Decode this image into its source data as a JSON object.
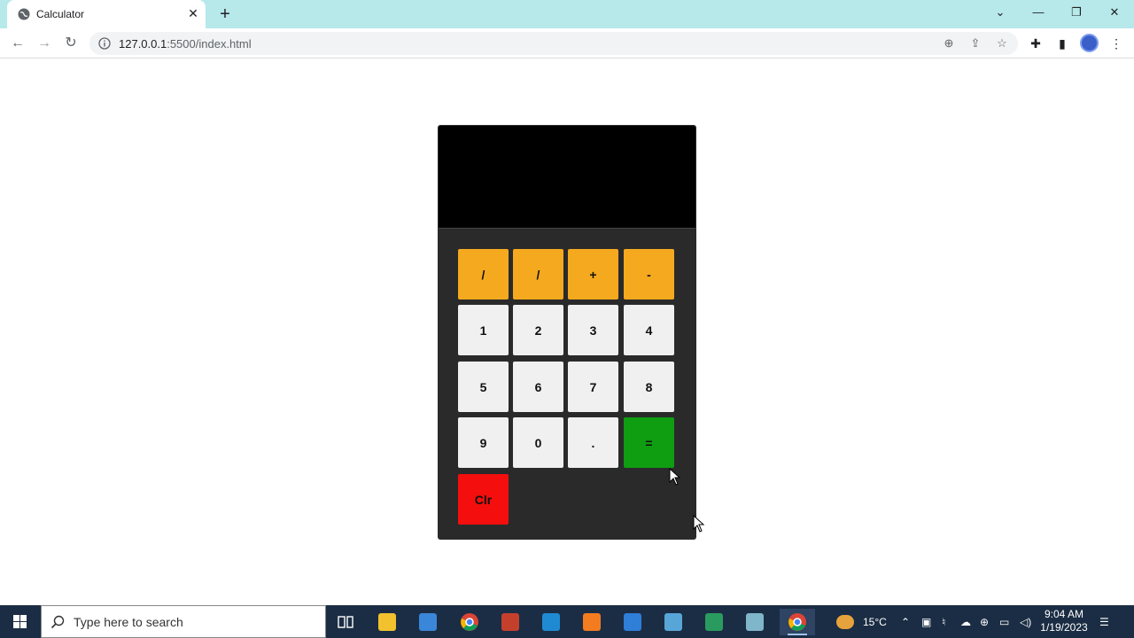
{
  "browser": {
    "tab_title": "Calculator",
    "url_host": "127.0.0.1",
    "url_rest": ":5500/index.html",
    "window_controls": [
      "chevron-down",
      "minimize",
      "restore",
      "close"
    ]
  },
  "calculator": {
    "display_value": "",
    "operator_keys": [
      "/",
      "/",
      "+",
      "-"
    ],
    "number_rows": [
      [
        "1",
        "2",
        "3",
        "4"
      ],
      [
        "5",
        "6",
        "7",
        "8"
      ],
      [
        "9",
        "0",
        "."
      ]
    ],
    "equals_label": "=",
    "clear_label": "Clr",
    "colors": {
      "operator": "#f5a91f",
      "number": "#f0f0f0",
      "equals": "#0f9d12",
      "clear": "#f40e0e",
      "body": "#2a2a2a",
      "display": "#000000"
    }
  },
  "taskbar": {
    "search_placeholder": "Type here to search",
    "apps": [
      "task-view",
      "file-explorer",
      "store",
      "chrome",
      "powerpoint",
      "vscode",
      "xampp",
      "mail",
      "app-8",
      "app-9",
      "app-10",
      "chrome-active"
    ],
    "weather": "15°C",
    "time": "9:04 AM",
    "date": "1/19/2023"
  }
}
